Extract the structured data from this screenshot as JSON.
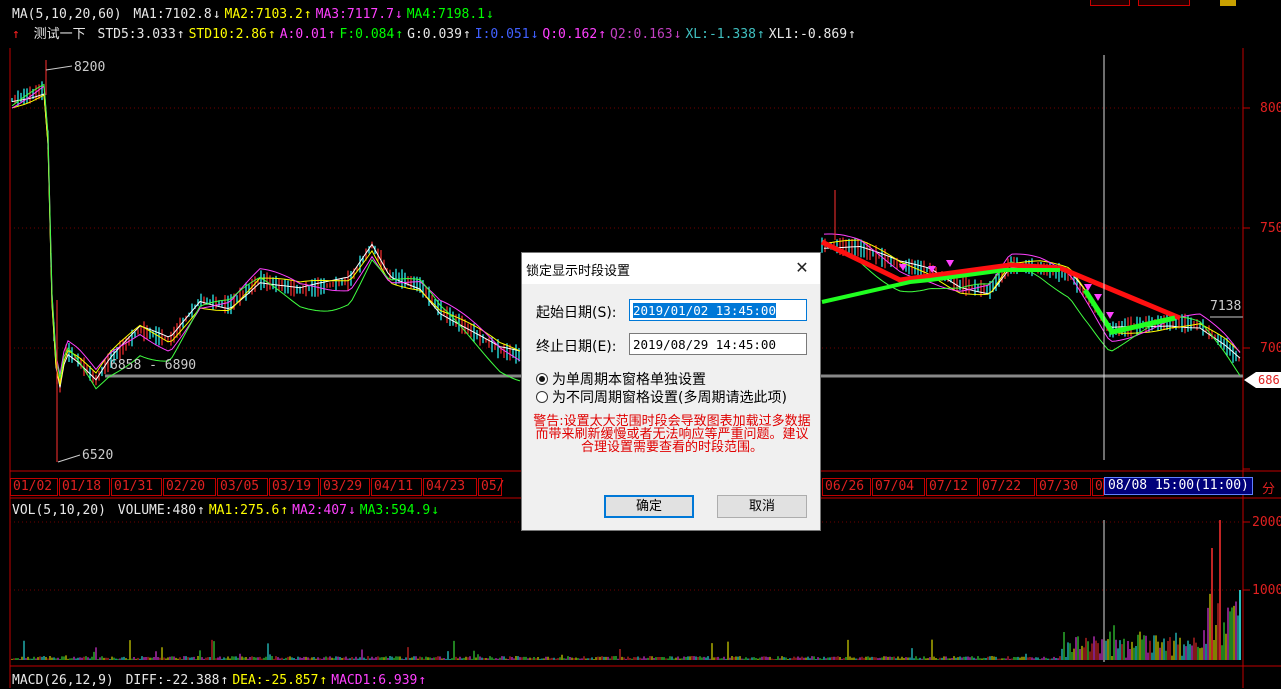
{
  "top_ma_row": {
    "label": "MA(5,10,20,60)",
    "items": [
      {
        "text": "MA1:7102.8",
        "color": "#e8e8e8",
        "dir": "dn"
      },
      {
        "text": "MA2:7103.2",
        "color": "#ffff00",
        "dir": "up"
      },
      {
        "text": "MA3:7117.7",
        "color": "#ff40ff",
        "dir": "dn"
      },
      {
        "text": "MA4:7198.1",
        "color": "#00ff00",
        "dir": "dn"
      }
    ]
  },
  "indicator_row": {
    "label": "测试一下",
    "items": [
      {
        "text": "STD5:3.033",
        "color": "#e8e8e8",
        "dir": "up"
      },
      {
        "text": "STD10:2.86",
        "color": "#ffff00",
        "dir": "up"
      },
      {
        "text": "A:0.01",
        "color": "#ff40ff",
        "dir": "up"
      },
      {
        "text": "F:0.084",
        "color": "#00ff00",
        "dir": "up"
      },
      {
        "text": "G:0.039",
        "color": "#e8e8e8",
        "dir": "up"
      },
      {
        "text": "I:0.051",
        "color": "#4060ff",
        "dir": "dn"
      },
      {
        "text": "Q:0.162",
        "color": "#ff40ff",
        "dir": "up"
      },
      {
        "text": "Q2:0.163",
        "color": "#c040c0",
        "dir": "dn"
      },
      {
        "text": "XL:-1.338",
        "color": "#40c0c0",
        "dir": "up"
      },
      {
        "text": "XL1:-0.869",
        "color": "#e8e8e8",
        "dir": "up"
      }
    ]
  },
  "price_chart": {
    "annotations": {
      "high": "8200",
      "low": "6520",
      "range": "6858 - 6890",
      "right_marker": "7138"
    },
    "right_axis": [
      "800",
      "750",
      "700"
    ],
    "current_price": "686"
  },
  "dates": [
    "01/02",
    "01/18",
    "01/31",
    "02/20",
    "03/05",
    "03/19",
    "03/29",
    "04/11",
    "04/23",
    "05/",
    "",
    "",
    "",
    "",
    "",
    "06/26",
    "07/04",
    "07/12",
    "07/22",
    "07/30",
    "0"
  ],
  "cursor_readout": "08/08 15:00(11:00)",
  "cursor_unit": "分",
  "vol_row": {
    "label": "VOL(5,10,20)",
    "items": [
      {
        "text": "VOLUME:480",
        "color": "#e8e8e8",
        "dir": "up"
      },
      {
        "text": "MA1:275.6",
        "color": "#ffff00",
        "dir": "up"
      },
      {
        "text": "MA2:407",
        "color": "#ff40ff",
        "dir": "dn"
      },
      {
        "text": "MA3:594.9",
        "color": "#00ff00",
        "dir": "dn"
      }
    ]
  },
  "vol_axis": [
    "2000",
    "1000"
  ],
  "macd_row": {
    "label": "MACD(26,12,9)",
    "items": [
      {
        "text": "DIFF:-22.388",
        "color": "#e8e8e8",
        "dir": "up"
      },
      {
        "text": "DEA:-25.857",
        "color": "#ffff00",
        "dir": "up"
      },
      {
        "text": "MACD1:6.939",
        "color": "#ff40ff",
        "dir": "up"
      }
    ]
  },
  "dialog": {
    "title": "锁定显示时段设置",
    "start_label": "起始日期(S):",
    "start_value": "2019/01/02 13:45:00",
    "end_label": "终止日期(E):",
    "end_value": "2019/08/29 14:45:00",
    "radio1": "为单周期本窗格单独设置",
    "radio2": "为不同周期窗格设置(多周期请选此项)",
    "warning": "警告:设置太大范围时段会导致图表加载过多数据而带来刷新缓慢或者无法响应等严重问题。建议合理设置需要查看的时段范围。",
    "ok": "确定",
    "cancel": "取消"
  }
}
